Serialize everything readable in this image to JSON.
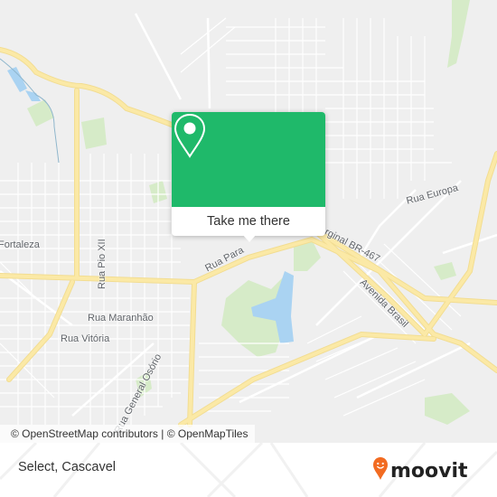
{
  "map": {
    "colors": {
      "background": "#efefef",
      "major_road": "#fbe9a6",
      "street": "#ffffff",
      "park": "#d6ebc8",
      "water": "#aad3f2"
    },
    "street_labels": [
      {
        "id": "fortaleza",
        "text": "Fortaleza"
      },
      {
        "id": "rua-pio-xii",
        "text": "Rua Pio XII"
      },
      {
        "id": "rua-maranhao",
        "text": "Rua Maranhão"
      },
      {
        "id": "rua-vitoria",
        "text": "Rua Vitória"
      },
      {
        "id": "rua-general-osorio",
        "text": "Rua General Osório"
      },
      {
        "id": "rua-parana",
        "text": "Rua Para"
      },
      {
        "id": "marginal-br-467",
        "text": "rginal BR-467"
      },
      {
        "id": "avenida-brasil",
        "text": "Avenida Brasil"
      },
      {
        "id": "rua-europa",
        "text": "Rua Europa"
      }
    ],
    "attribution": "© OpenStreetMap contributors | © OpenMapTiles"
  },
  "popup": {
    "icon": "map-pin-icon",
    "button_label": "Take me there",
    "accent_color": "#1fb96a"
  },
  "footer": {
    "place_name": "Select, Cascavel",
    "brand": "moovit",
    "brand_color": "#f26b21"
  }
}
